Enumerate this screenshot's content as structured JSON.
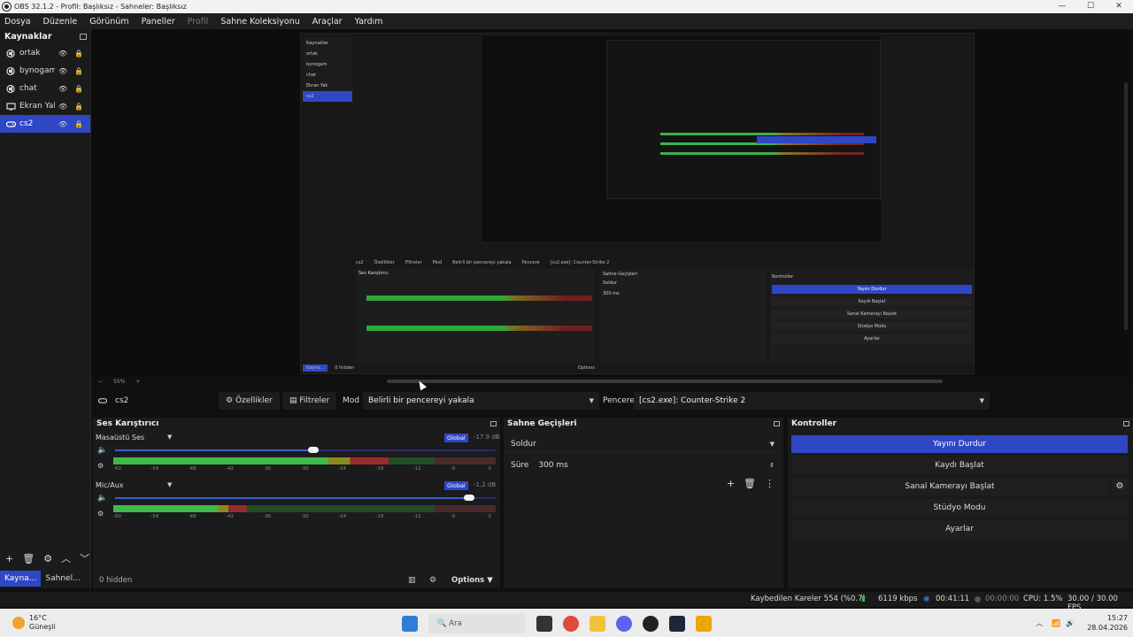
{
  "window": {
    "title": "OBS 32.1.2 - Profil: Başlıksız - Sahneler: Başlıksız",
    "min": "—",
    "max": "☐",
    "close": "✕"
  },
  "menu": [
    "Dosya",
    "Düzenle",
    "Görünüm",
    "Paneller",
    "Profil",
    "Sahne Koleksiyonu",
    "Araçlar",
    "Yardım"
  ],
  "sources": {
    "title": "Kaynaklar",
    "items": [
      {
        "name": "ortak",
        "icon": "speaker-icon"
      },
      {
        "name": "bynogam",
        "icon": "speaker-icon"
      },
      {
        "name": "chat",
        "icon": "speaker-icon"
      },
      {
        "name": "Ekran Yak",
        "icon": "monitor-icon"
      },
      {
        "name": "cs2",
        "icon": "gamepad-icon",
        "selected": true
      }
    ],
    "tools": [
      "+",
      "🗑",
      "⚙",
      "︿",
      "﹀"
    ]
  },
  "dock_tabs": [
    "Kayna...",
    "Sahnel..."
  ],
  "preview": {
    "zoom": "55%",
    "nested": {
      "sources_title": "Kaynaklar",
      "items": [
        "ortak",
        "bynogam",
        "chat",
        "Ekran Yak",
        "cs2"
      ],
      "toolbar": [
        "cs2",
        "Özellikler",
        "Filtreler",
        "Mod",
        "Belirli bir pencereyi yakala",
        "Pencere",
        "[cs2.exe]: Counter-Strike 2"
      ],
      "mixer_title": "Ses Karıştırıcı",
      "trans_title": "Sahne Geçişleri",
      "trans_value": "Soldur",
      "duration": "300 ms",
      "ctrl_title": "Kontroller",
      "ctrl": [
        "Yayını Durdur",
        "Kaydı Başlat",
        "Sanal Kamerayı Başlat",
        "Stüdyo Modu",
        "Ayarlar"
      ],
      "hidden": "0 hidden",
      "options": "Options"
    }
  },
  "context": {
    "scene": "cs2",
    "properties": "Özellikler",
    "filters": "Filtreler",
    "mode_label": "Mod",
    "mode_value": "Belirli bir pencereyi yakala",
    "window_label": "Pencere",
    "window_value": "[cs2.exe]: Counter-Strike 2"
  },
  "mixer": {
    "title": "Ses Karıştırıcı",
    "channels": [
      {
        "name": "Masaüstü Ses",
        "global": "Global",
        "db": "-17.9 dB",
        "volume": 0.52,
        "level": 0.72
      },
      {
        "name": "Mic/Aux",
        "global": "Global",
        "db": "-1.2 dB",
        "volume": 0.93,
        "level": 0.35
      }
    ],
    "ticks": [
      "-60",
      "-54",
      "-48",
      "-42",
      "-36",
      "-30",
      "-24",
      "-18",
      "-12",
      "-6",
      "0"
    ],
    "hidden": "0 hidden",
    "options": "Options"
  },
  "transitions": {
    "title": "Sahne Geçişleri",
    "type": "Soldur",
    "duration_label": "Süre",
    "duration": "300 ms"
  },
  "controls": {
    "title": "Kontroller",
    "stop_stream": "Yayını Durdur",
    "start_record": "Kaydı Başlat",
    "virtual_cam": "Sanal Kamerayı Başlat",
    "studio": "Stüdyo Modu",
    "settings": "Ayarlar"
  },
  "status": {
    "dropped": "Kaybedilen Kareler 554 (%0.7)",
    "bitrate": "6119 kbps",
    "stream_time": "00:41:11",
    "record_time": "00:00:00",
    "cpu": "CPU: 1.5%",
    "fps": "30.00 / 30.00 FPS"
  },
  "taskbar": {
    "temp": "16°C",
    "weather": "Güneşli",
    "search": "Ara",
    "time": "15:27",
    "date": "28.04.2026"
  },
  "colors": {
    "accent": "#2f47c6",
    "meter_green": "#41b84a",
    "meter_yellow": "#8a8a24",
    "meter_red": "#9a2b2b"
  }
}
